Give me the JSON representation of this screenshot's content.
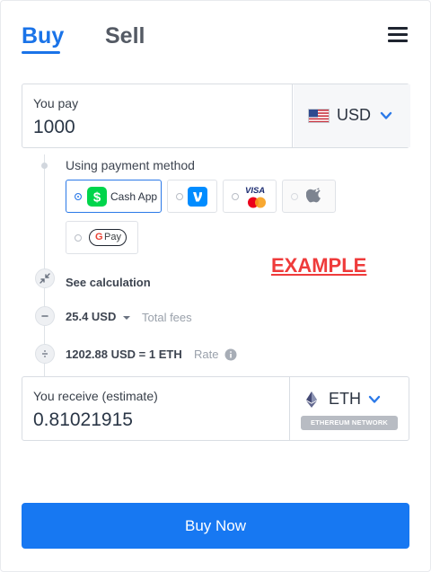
{
  "tabs": {
    "buy": "Buy",
    "sell": "Sell"
  },
  "pay": {
    "label": "You pay",
    "amount": "1000",
    "currency": "USD"
  },
  "payment_method": {
    "label": "Using payment method",
    "options": [
      {
        "name": "Cash App",
        "selected": true
      },
      {
        "name": "Venmo",
        "selected": false
      },
      {
        "name": "Visa / Mastercard",
        "selected": false
      },
      {
        "name": "Apple Pay",
        "selected": false,
        "disabled": true
      },
      {
        "name": "Google Pay",
        "selected": false
      }
    ],
    "cash_app_label": "Cash App",
    "visa_label": "VISA",
    "gpay_label": "Pay"
  },
  "calculation": {
    "label": "See calculation"
  },
  "fees": {
    "amount": "25.4 USD",
    "label": "Total fees"
  },
  "rate": {
    "value": "1202.88 USD = 1 ETH",
    "label": "Rate"
  },
  "watermark": "EXAMPLE",
  "receive": {
    "label": "You receive (estimate)",
    "amount": "0.81021915",
    "currency": "ETH",
    "network": "ETHEREUM NETWORK"
  },
  "action": {
    "label": "Buy Now"
  },
  "colors": {
    "accent": "#1778f2",
    "watermark": "#ef3b3b",
    "cashapp": "#00d54b",
    "venmo": "#008cff"
  },
  "icons": [
    "menu-icon",
    "chevron-down-icon",
    "us-flag-icon",
    "collapse-icon",
    "minus-icon",
    "divide-icon",
    "info-icon",
    "ethereum-icon",
    "caret-down-icon",
    "cash-app-icon",
    "venmo-icon",
    "visa-icon",
    "mastercard-icon",
    "apple-icon",
    "google-g-icon"
  ]
}
